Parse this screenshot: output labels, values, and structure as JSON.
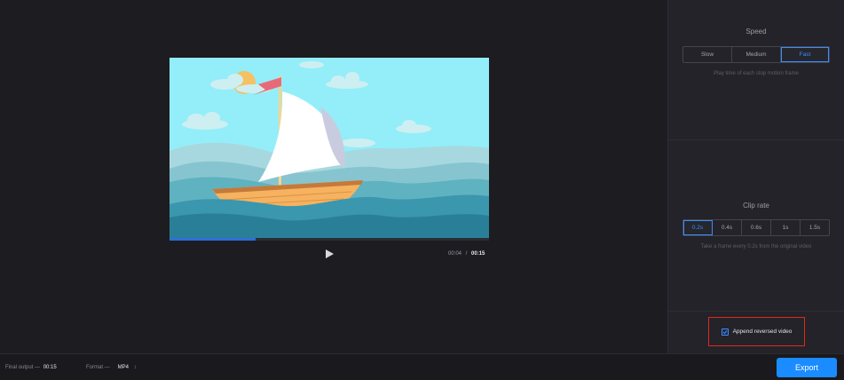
{
  "player": {
    "progress_fraction": 0.27,
    "current_time": "00:04",
    "separator": "/",
    "total_time": "00:15"
  },
  "speed": {
    "title": "Speed",
    "options": [
      "Slow",
      "Medium",
      "Fast"
    ],
    "selected": "Fast",
    "hint": "Play time of each stop motion frame"
  },
  "clip_rate": {
    "title": "Clip rate",
    "options": [
      "0.2s",
      "0.4s",
      "0.6s",
      "1s",
      "1.5s"
    ],
    "selected": "0.2s",
    "hint": "Take a frame every 0.2s from the original video"
  },
  "append": {
    "label": "Append reversed video",
    "checked": true
  },
  "bottom_bar": {
    "final_output_label": "Final output —",
    "final_output_value": "00:15",
    "format_label": "Format —",
    "format_value": "MP4",
    "format_arrow": "↕",
    "export_label": "Export"
  },
  "colors": {
    "accent": "#1a8cff",
    "highlight_box": "#e0291b"
  }
}
